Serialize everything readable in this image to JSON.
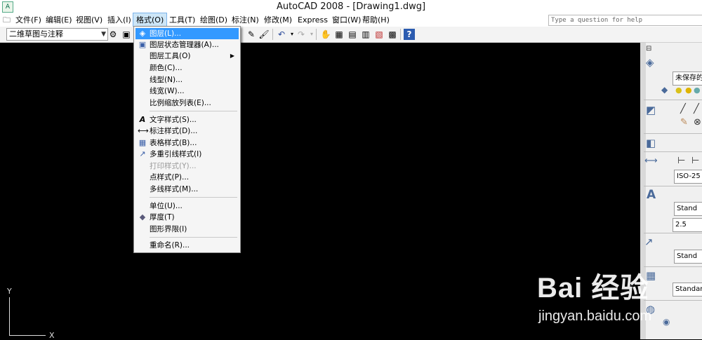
{
  "window": {
    "title": "AutoCAD 2008 - [Drawing1.dwg]",
    "app_icon": "autocad-icon"
  },
  "menubar": {
    "items": [
      {
        "label": "文件(F)"
      },
      {
        "label": "编辑(E)"
      },
      {
        "label": "视图(V)"
      },
      {
        "label": "插入(I)"
      },
      {
        "label": "格式(O)"
      },
      {
        "label": "工具(T)"
      },
      {
        "label": "绘图(D)"
      },
      {
        "label": "标注(N)"
      },
      {
        "label": "修改(M)"
      },
      {
        "label": "Express"
      },
      {
        "label": "窗口(W)"
      },
      {
        "label": "帮助(H)"
      }
    ],
    "help_placeholder": "Type a question for help"
  },
  "toolbar": {
    "workspace": "二维草图与注释"
  },
  "format_menu": {
    "items": [
      {
        "label": "图层(L)...",
        "icon": "layers-icon"
      },
      {
        "label": "图层状态管理器(A)...",
        "icon": "layer-state-icon"
      },
      {
        "label": "图层工具(O)"
      },
      {
        "label": "颜色(C)..."
      },
      {
        "label": "线型(N)..."
      },
      {
        "label": "线宽(W)..."
      },
      {
        "label": "比例缩放列表(E)..."
      },
      {
        "label": "文字样式(S)...",
        "icon": "text-style-icon"
      },
      {
        "label": "标注样式(D)...",
        "icon": "dim-style-icon"
      },
      {
        "label": "表格样式(B)...",
        "icon": "table-style-icon"
      },
      {
        "label": "多重引线样式(I)",
        "icon": "mleader-style-icon"
      },
      {
        "label": "打印样式(Y)..."
      },
      {
        "label": "点样式(P)..."
      },
      {
        "label": "多线样式(M)..."
      },
      {
        "label": "单位(U)..."
      },
      {
        "label": "厚度(T)",
        "icon": "thickness-icon"
      },
      {
        "label": "图形界限(I)"
      },
      {
        "label": "重命名(R)..."
      }
    ]
  },
  "dashboard": {
    "layer_state": "未保存的",
    "dim_style": "ISO-25",
    "text_style": "Stand",
    "text_height": "2.5",
    "mleader_style": "Stand",
    "table_style": "Standard"
  },
  "ucs": {
    "y_label": "Y",
    "x_label": "X"
  },
  "watermark": {
    "brand": "Bai 经验",
    "url": "jingyan.baidu.com"
  }
}
